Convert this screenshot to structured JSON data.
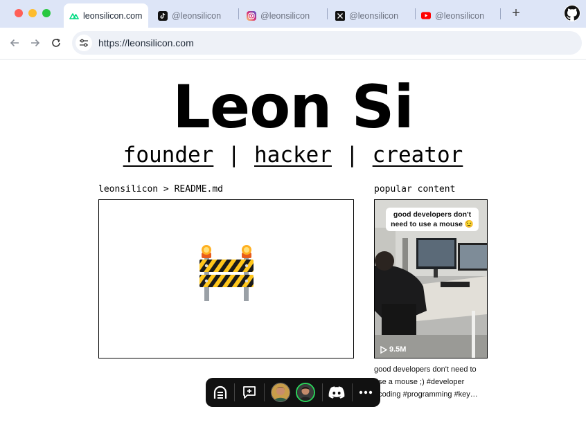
{
  "browser": {
    "tabs": [
      {
        "label": "leonsilicon.com",
        "favicon": "nuxt-icon",
        "active": true
      },
      {
        "label": "@leonsilicon",
        "favicon": "tiktok-icon",
        "active": false
      },
      {
        "label": "@leonsilicon",
        "favicon": "instagram-icon",
        "active": false
      },
      {
        "label": "@leonsilicon",
        "favicon": "x-icon",
        "active": false
      },
      {
        "label": "@leonsilicon",
        "favicon": "youtube-icon",
        "active": false
      }
    ],
    "new_tab": "+",
    "url": "https://leonsilicon.com"
  },
  "page": {
    "name": "Leon Si",
    "roles": [
      "founder",
      "hacker",
      "creator"
    ],
    "separator": "|",
    "readme_label": "leonsilicon > README.md",
    "readme_icon": "construction-barrier-icon",
    "popular_label": "popular content",
    "video": {
      "overlay_text": "good developers don't need to use a mouse 😉",
      "views": "9.5M",
      "caption": "good developers don't need to use a mouse ;) #developer #coding #programming #key…"
    }
  },
  "floating_toolbar": {
    "items": [
      "app-logo-icon",
      "comment-add-icon",
      "avatar",
      "avatar",
      "discord-icon",
      "more-icon"
    ]
  },
  "colors": {
    "tab_bar_bg": "#dde5f7",
    "omnibox_bg": "#eef1f7",
    "floating_toolbar_bg": "#111111"
  }
}
